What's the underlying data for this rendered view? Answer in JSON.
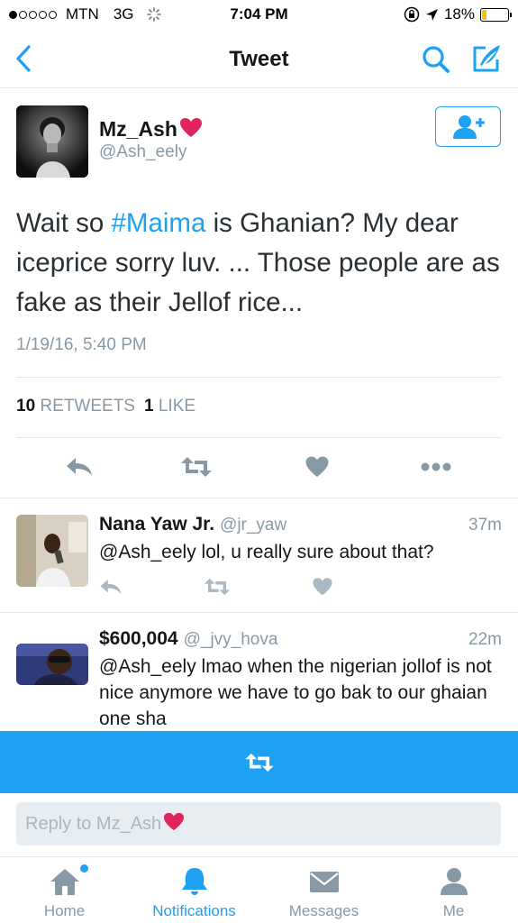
{
  "status_bar": {
    "carrier": "MTN",
    "network": "3G",
    "time": "7:04 PM",
    "battery": "18%",
    "battery_level": 0.18,
    "signal_bars": 1
  },
  "nav": {
    "title": "Tweet",
    "back_icon": "chevron-left-icon",
    "search_icon": "search-icon",
    "compose_icon": "compose-icon"
  },
  "tweet": {
    "author_name": "Mz_Ash",
    "author_handle": "@Ash_eely",
    "text_before": "Wait so ",
    "hashtag": "#Maima",
    "text_after": " is Ghanian? My dear iceprice sorry luv. ... Those people are as fake as their Jellof rice...",
    "timestamp": "1/19/16, 5:40 PM",
    "retweets_count": "10",
    "retweets_label": "RETWEETS",
    "likes_count": "1",
    "likes_label": "LIKE"
  },
  "replies": [
    {
      "name": "Nana Yaw Jr.",
      "handle": "@jr_yaw",
      "time": "37m",
      "text": "@Ash_eely lol, u really sure about that?"
    },
    {
      "name": "$600,004",
      "handle": "@_jvy_hova",
      "time": "22m",
      "text": "@Ash_eely lmao when the nigerian jollof is not nice anymore we have to go bak to our ghaian one sha"
    }
  ],
  "reply_box": {
    "placeholder": "Reply to Mz_Ash"
  },
  "tabs": [
    {
      "label": "Home",
      "icon": "home-icon",
      "active": false
    },
    {
      "label": "Notifications",
      "icon": "bell-icon",
      "active": true
    },
    {
      "label": "Messages",
      "icon": "envelope-icon",
      "active": false
    },
    {
      "label": "Me",
      "icon": "person-icon",
      "active": false
    }
  ],
  "colors": {
    "accent": "#1da1f2",
    "muted": "#8899a6",
    "heart": "#e0245e",
    "battery": "#f5c400"
  }
}
